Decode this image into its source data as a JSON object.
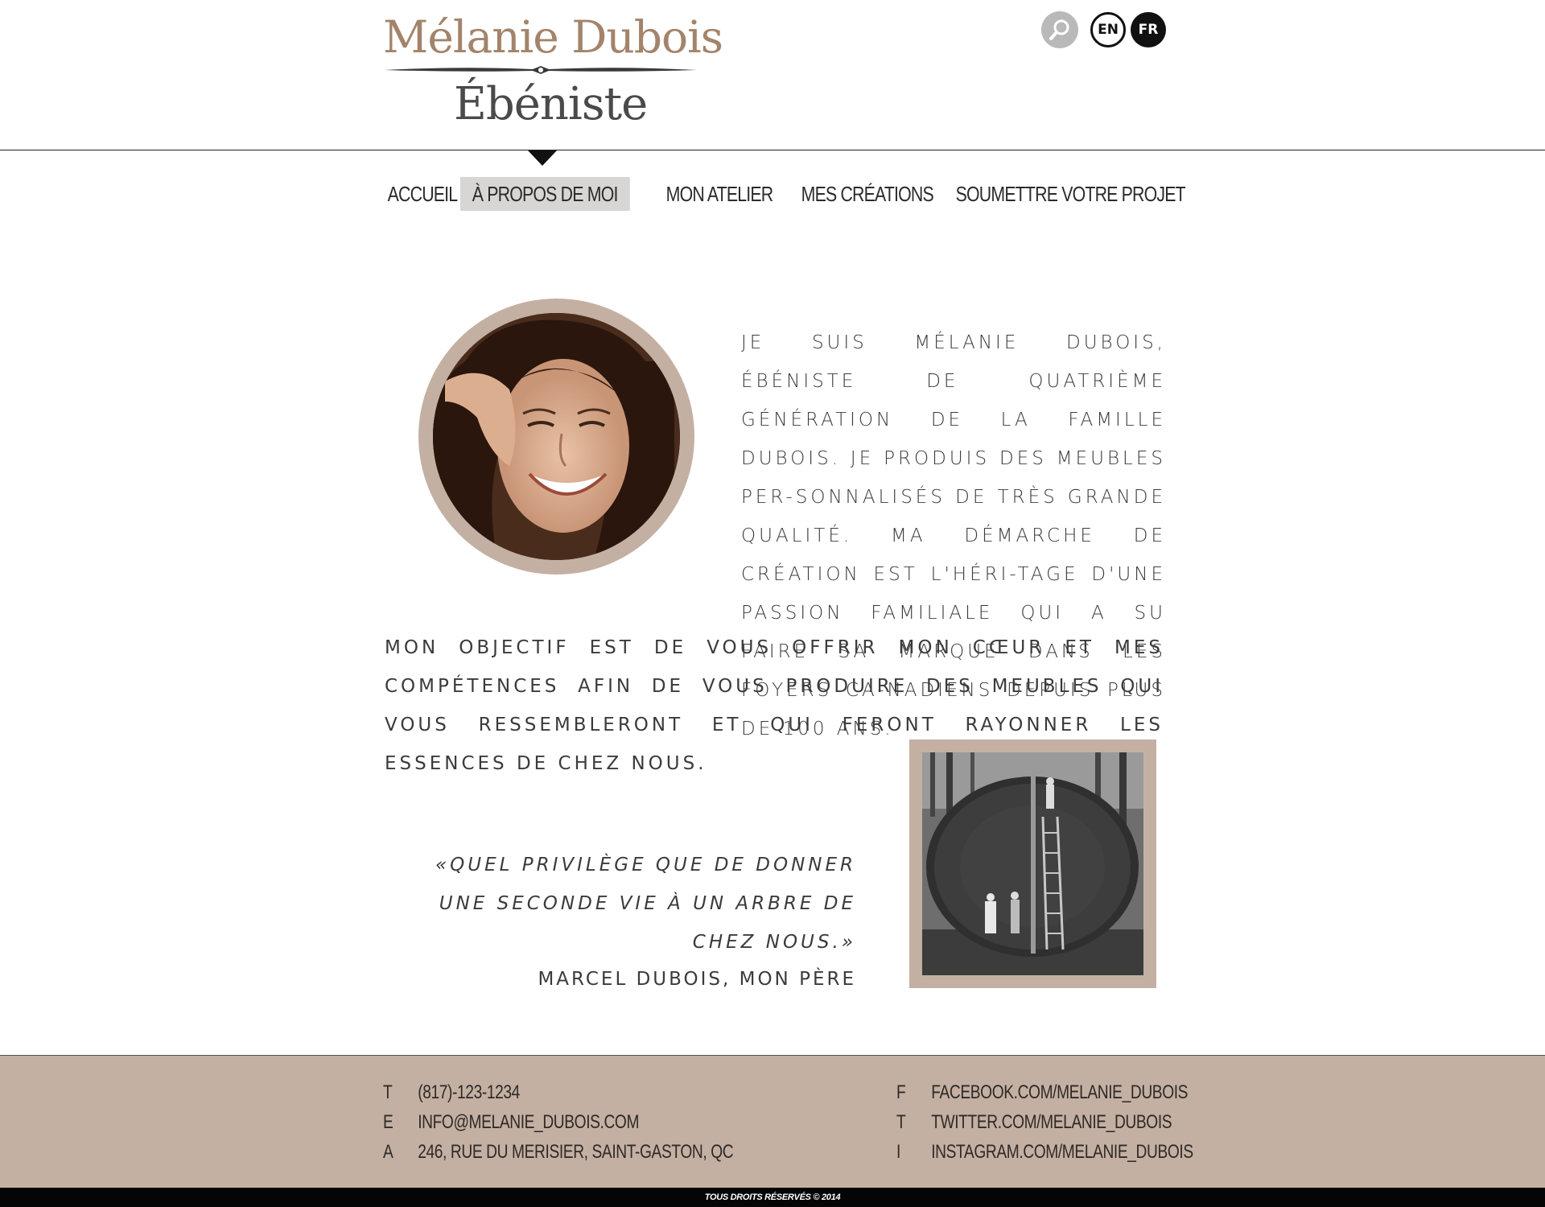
{
  "header": {
    "logo_name": "Mélanie Dubois",
    "logo_subtitle": "Ébéniste",
    "lang_en": "EN",
    "lang_fr": "FR",
    "icons": {
      "search": "search-icon"
    }
  },
  "nav": {
    "items": [
      {
        "label": "Accueil",
        "active": false
      },
      {
        "label": "À propos de moi",
        "active": true
      },
      {
        "label": "Mon atelier",
        "active": false
      },
      {
        "label": "Mes créations",
        "active": false
      },
      {
        "label": "Soumettre votre projet",
        "active": false
      }
    ]
  },
  "main": {
    "intro_text": "Je suis Mélanie Dubois, ébéniste de quatrième génération de la famille Dubois. Je produis des meubles per-sonnalisés de très grande qualité. Ma démarche de création est l'héri-tage d'une passion familiale qui a su faire sa marque dans les foyers ca-nadiens depuis plus de 100 ans.",
    "objective_text": "Mon objectif est de vous offrir mon cœur et mes compétences afin de vous produire des meubles qui vous ressembleront et qui feront rayonner les essences de chez nous.",
    "quote_text": "«Quel privilège que de donner une seconde vie à un arbre de chez nous.»",
    "quote_author": "Marcel Dubois, mon père"
  },
  "footer": {
    "phone_key": "T",
    "phone": "(817)-123-1234",
    "email_key": "E",
    "email": "info@melanie_dubois.com",
    "address_key": "A",
    "address": "246, rue du Merisier, Saint-Gaston, QC",
    "facebook_key": "F",
    "facebook": "facebook.com/melanie_dubois",
    "twitter_key": "T",
    "twitter": "twitter.com/melanie_dubois",
    "instagram_key": "I",
    "instagram": "instagram.com/melanie_dubois",
    "copyright": "TOUS DROITS RÉSERVÉS © 2014"
  },
  "colors": {
    "accent": "#a3846a",
    "frame": "#c4b0a2",
    "nav_active": "#d8d6d4",
    "footer_bg": "#c4b0a2",
    "dark": "#111111"
  }
}
